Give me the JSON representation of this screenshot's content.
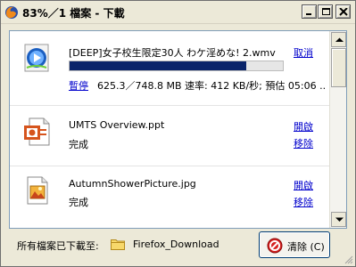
{
  "window": {
    "title": "83%／1 檔案 - 下載"
  },
  "downloads": [
    {
      "filename": "[DEEP]女子校生限定30人 わケ淫めな! 2.wmv",
      "icon": "media-player-icon",
      "progress": 0.83,
      "status": "625.3／748.8 MB 速率: 412 KB/秒; 預估 05:06 ...",
      "actions": {
        "primary": "暫停",
        "secondary": "取消"
      }
    },
    {
      "filename": "UMTS Overview.ppt",
      "icon": "powerpoint-file-icon",
      "status": "完成",
      "actions": {
        "open": "開啟",
        "remove": "移除"
      }
    },
    {
      "filename": "AutumnShowerPicture.jpg",
      "icon": "image-file-icon",
      "status": "完成",
      "actions": {
        "open": "開啟",
        "remove": "移除"
      }
    }
  ],
  "footer": {
    "label": "所有檔案已下載至:",
    "folder": "Firefox_Download",
    "folder_icon": "folder-icon",
    "clear_button": "清除 (C)"
  },
  "colors": {
    "progress_fill": "#0a246a",
    "link": "#0000cc",
    "window_bg": "#ece9d8"
  }
}
